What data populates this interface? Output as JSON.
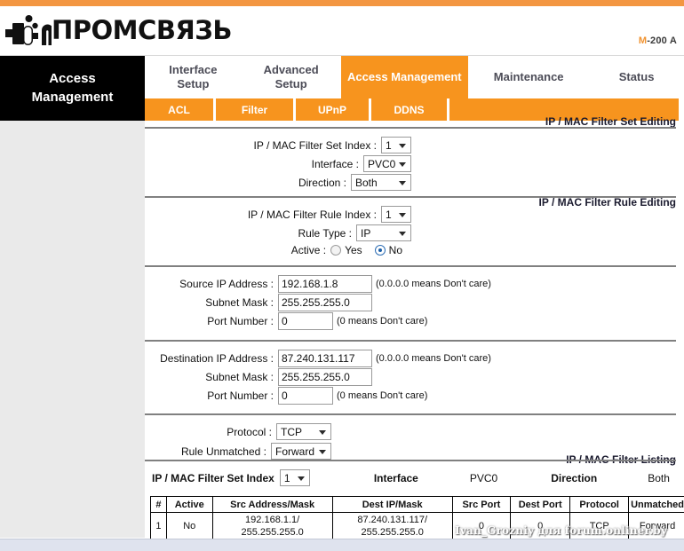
{
  "brand": {
    "name": "ПРОМСВЯЗЬ",
    "model_prefix": "M",
    "model_suffix": "-200 A",
    "logo_icon": "plug-logo-icon"
  },
  "nav": {
    "active_block_line1": "Access",
    "active_block_line2": "Management",
    "tabs": [
      {
        "line1": "Interface",
        "line2": "Setup",
        "active": false
      },
      {
        "line1": "Advanced",
        "line2": "Setup",
        "active": false
      },
      {
        "line1": "Access Management",
        "line2": "",
        "active": true
      },
      {
        "line1": "Maintenance",
        "line2": "",
        "active": false
      },
      {
        "line1": "Status",
        "line2": "",
        "active": false
      }
    ],
    "subtabs": [
      {
        "label": "ACL"
      },
      {
        "label": "Filter"
      },
      {
        "label": "UPnP"
      },
      {
        "label": "DDNS"
      }
    ]
  },
  "gutter": {
    "set_editing": "IP / MAC Filter Set Editing",
    "rule_editing": "IP / MAC Filter Rule Editing",
    "listing": "IP / MAC Filter Listing"
  },
  "set_editing": {
    "index_label": "IP / MAC Filter Set Index :",
    "index_value": "1",
    "interface_label": "Interface :",
    "interface_value": "PVC0",
    "direction_label": "Direction :",
    "direction_value": "Both"
  },
  "rule_editing": {
    "rule_index_label": "IP / MAC Filter Rule Index :",
    "rule_index_value": "1",
    "rule_type_label": "Rule Type :",
    "rule_type_value": "IP",
    "active_label": "Active :",
    "active_yes": "Yes",
    "active_no": "No",
    "active_selected": "No"
  },
  "source": {
    "ip_label": "Source IP Address :",
    "ip_value": "192.168.1.8",
    "ip_hint": "(0.0.0.0 means Don't care)",
    "mask_label": "Subnet Mask :",
    "mask_value": "255.255.255.0",
    "port_label": "Port Number :",
    "port_value": "0",
    "port_hint": "(0 means Don't care)"
  },
  "destination": {
    "ip_label": "Destination IP Address :",
    "ip_value": "87.240.131.117",
    "ip_hint": "(0.0.0.0 means Don't care)",
    "mask_label": "Subnet Mask :",
    "mask_value": "255.255.255.0",
    "port_label": "Port Number :",
    "port_value": "0",
    "port_hint": "(0 means Don't care)"
  },
  "protocol_section": {
    "protocol_label": "Protocol :",
    "protocol_value": "TCP",
    "unmatched_label": "Rule Unmatched :",
    "unmatched_value": "Forward"
  },
  "listing": {
    "set_index_label": "IP / MAC Filter Set Index",
    "set_index_value": "1",
    "interface_label": "Interface",
    "interface_value": "PVC0",
    "direction_label": "Direction",
    "direction_value": "Both",
    "columns": [
      "#",
      "Active",
      "Src Address/Mask",
      "Dest IP/Mask",
      "Src Port",
      "Dest Port",
      "Protocol",
      "Unmatched"
    ],
    "rows": [
      {
        "num": "1",
        "active": "No",
        "src_line1": "192.168.1.1/",
        "src_line2": "255.255.255.0",
        "dest_line1": "87.240.131.117/",
        "dest_line2": "255.255.255.0",
        "src_port": "0",
        "dest_port": "0",
        "protocol": "TCP",
        "unmatched": "Forward"
      }
    ]
  },
  "watermark": "Ivan_Grozniy для forum.onliner.by",
  "colors": {
    "accent_orange": "#f7941e",
    "top_rule_orange": "#f39642",
    "active_black": "#000000",
    "gutter_gray": "#eaeaea",
    "rule_gray": "#808080"
  }
}
